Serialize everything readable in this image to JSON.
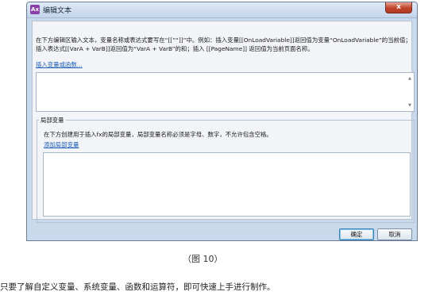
{
  "window": {
    "app_icon_glyph": "Ax",
    "title": "编辑文本",
    "close_glyph": "x"
  },
  "intro": {
    "text": "在下方编辑区输入文本，变量名称或表达式要写在“[[”“]]”中。例如：插入变量[[OnLoadVariable]]返回值为变量“OnLoadVariable”的当前值；插入表达式[[VarA + VarB]]返回值为“VarA + VarB”的和；插入 [[PageName]] 返回值为当前页面名称。",
    "insert_link": "插入变量或函数..."
  },
  "local_vars": {
    "legend": "局部变量",
    "description": "在下方创建用于插入fx的局部变量，局部变量名称必须是字母、数字，不允许包含空格。",
    "add_link": "添加局部变量"
  },
  "buttons": {
    "ok": "确定",
    "cancel": "取消"
  },
  "scroll": {
    "up": "▲",
    "down": "▼"
  },
  "caption": "（图 10）",
  "footer": "只要了解自定义变量、系统变量、函数和运算符，即可快速上手进行制作。",
  "colors": {
    "dialog_bg": "#c9d9ec",
    "content_bg": "#f2f4f7",
    "link": "#1f5fb8",
    "close_button": "#c0432c"
  }
}
